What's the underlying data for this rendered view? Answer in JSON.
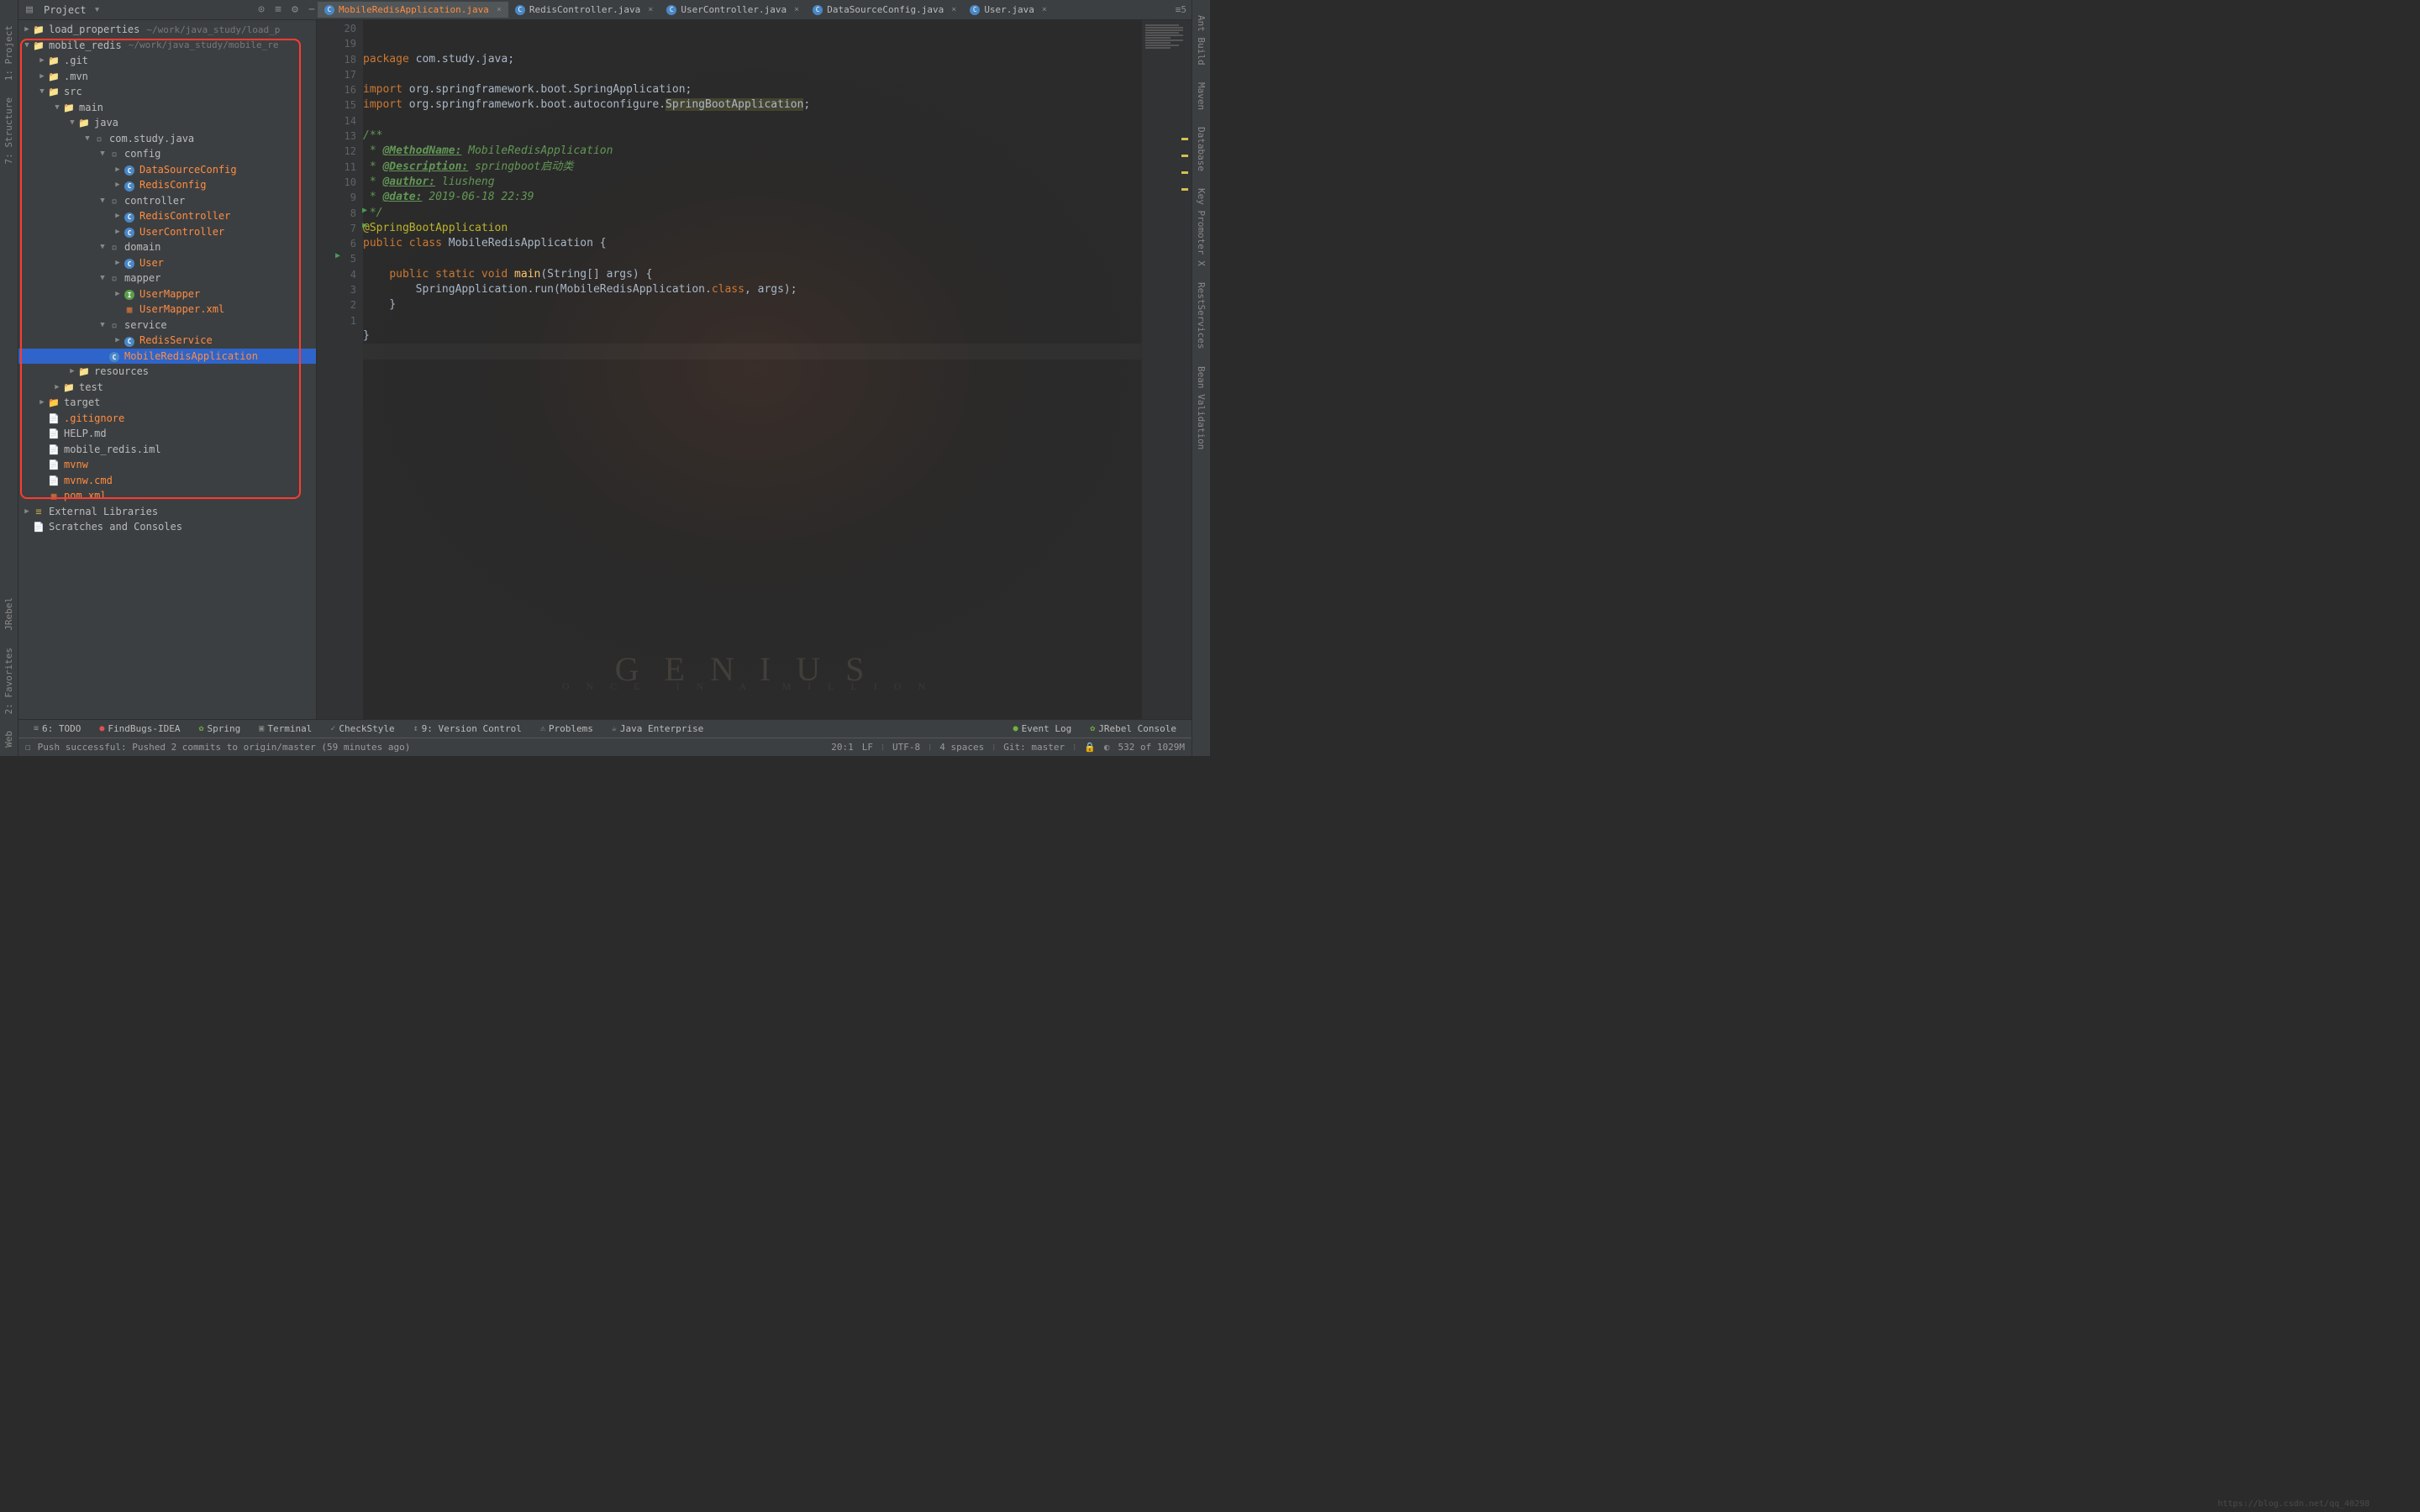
{
  "toolbar": {
    "project_label": "Project",
    "tabs": [
      {
        "label": "MobileRedisApplication.java",
        "active": true
      },
      {
        "label": "RedisController.java",
        "active": false
      },
      {
        "label": "UserController.java",
        "active": false
      },
      {
        "label": "DataSourceConfig.java",
        "active": false
      },
      {
        "label": "User.java",
        "active": false
      }
    ],
    "right_indicator": "≡5"
  },
  "left_tools": [
    "1: Project",
    "7: Structure",
    "JRebel",
    "2: Favorites",
    "Web"
  ],
  "right_tools": [
    "Ant Build",
    "Maven",
    "Database",
    "Key Promoter X",
    "RestServices",
    "Bean Validation"
  ],
  "tree": {
    "items": [
      {
        "depth": 0,
        "arrow": "▶",
        "icon": "folder",
        "label": "load_properties",
        "hint": "~/work/java_study/load_p",
        "hot": false
      },
      {
        "depth": 0,
        "arrow": "▼",
        "icon": "folder",
        "label": "mobile_redis",
        "hint": "~/work/java_study/mobile_re",
        "hot": false
      },
      {
        "depth": 1,
        "arrow": "▶",
        "icon": "folder",
        "label": ".git",
        "hot": false
      },
      {
        "depth": 1,
        "arrow": "▶",
        "icon": "folder",
        "label": ".mvn",
        "hot": false
      },
      {
        "depth": 1,
        "arrow": "▼",
        "icon": "folder",
        "label": "src",
        "hot": false
      },
      {
        "depth": 2,
        "arrow": "▼",
        "icon": "folder",
        "label": "main",
        "hot": false
      },
      {
        "depth": 3,
        "arrow": "▼",
        "icon": "folder",
        "label": "java",
        "hot": false
      },
      {
        "depth": 4,
        "arrow": "▼",
        "icon": "package",
        "label": "com.study.java",
        "hot": false
      },
      {
        "depth": 5,
        "arrow": "▼",
        "icon": "package",
        "label": "config",
        "hot": false
      },
      {
        "depth": 6,
        "arrow": "▶",
        "icon": "class",
        "label": "DataSourceConfig",
        "hot": true
      },
      {
        "depth": 6,
        "arrow": "▶",
        "icon": "class",
        "label": "RedisConfig",
        "hot": true
      },
      {
        "depth": 5,
        "arrow": "▼",
        "icon": "package",
        "label": "controller",
        "hot": false
      },
      {
        "depth": 6,
        "arrow": "▶",
        "icon": "class",
        "label": "RedisController",
        "hot": true
      },
      {
        "depth": 6,
        "arrow": "▶",
        "icon": "class",
        "label": "UserController",
        "hot": true
      },
      {
        "depth": 5,
        "arrow": "▼",
        "icon": "package",
        "label": "domain",
        "hot": false
      },
      {
        "depth": 6,
        "arrow": "▶",
        "icon": "class",
        "label": "User",
        "hot": true
      },
      {
        "depth": 5,
        "arrow": "▼",
        "icon": "package",
        "label": "mapper",
        "hot": false
      },
      {
        "depth": 6,
        "arrow": "▶",
        "icon": "interface",
        "label": "UserMapper",
        "hot": true
      },
      {
        "depth": 6,
        "arrow": "",
        "icon": "xml",
        "label": "UserMapper.xml",
        "hot": true
      },
      {
        "depth": 5,
        "arrow": "▼",
        "icon": "package",
        "label": "service",
        "hot": false
      },
      {
        "depth": 6,
        "arrow": "▶",
        "icon": "class",
        "label": "RedisService",
        "hot": true
      },
      {
        "depth": 5,
        "arrow": "",
        "icon": "class",
        "label": "MobileRedisApplication",
        "hot": true,
        "selected": true
      },
      {
        "depth": 3,
        "arrow": "▶",
        "icon": "folder",
        "label": "resources",
        "hot": false
      },
      {
        "depth": 2,
        "arrow": "▶",
        "icon": "folder",
        "label": "test",
        "hot": false
      },
      {
        "depth": 1,
        "arrow": "▶",
        "icon": "target",
        "label": "target",
        "hot": false
      },
      {
        "depth": 1,
        "arrow": "",
        "icon": "file",
        "label": ".gitignore",
        "hot": true
      },
      {
        "depth": 1,
        "arrow": "",
        "icon": "file",
        "label": "HELP.md",
        "hot": false
      },
      {
        "depth": 1,
        "arrow": "",
        "icon": "file",
        "label": "mobile_redis.iml",
        "hot": false
      },
      {
        "depth": 1,
        "arrow": "",
        "icon": "file",
        "label": "mvnw",
        "hot": true
      },
      {
        "depth": 1,
        "arrow": "",
        "icon": "file",
        "label": "mvnw.cmd",
        "hot": true
      },
      {
        "depth": 1,
        "arrow": "",
        "icon": "xml",
        "label": "pom.xml",
        "hot": true
      },
      {
        "depth": 0,
        "arrow": "▶",
        "icon": "lib",
        "label": "External Libraries",
        "hot": false
      },
      {
        "depth": 0,
        "arrow": "",
        "icon": "file",
        "label": "Scratches and Consoles",
        "hot": false
      }
    ]
  },
  "editor": {
    "lines": [
      "1",
      "2",
      "3",
      "4",
      "5",
      "6",
      "7",
      "8",
      "9",
      "10",
      "11",
      "12",
      "13",
      "14",
      "15",
      "16",
      "17",
      "18",
      "19",
      "20"
    ],
    "code_tokens": [
      [
        {
          "c": "kw",
          "t": "package "
        },
        {
          "c": "pkg",
          "t": "com.study.java"
        },
        {
          "c": "",
          "t": ";"
        }
      ],
      [],
      [
        {
          "c": "kw",
          "t": "import "
        },
        {
          "c": "pkg",
          "t": "org.springframework.boot.SpringApplication"
        },
        {
          "c": "",
          "t": ";"
        }
      ],
      [
        {
          "c": "kw",
          "t": "import "
        },
        {
          "c": "pkg",
          "t": "org.springframework.boot.autoconfigure."
        },
        {
          "c": "hl",
          "t": "SpringBootApplication"
        },
        {
          "c": "",
          "t": ";"
        }
      ],
      [],
      [
        {
          "c": "doc",
          "t": "/**"
        }
      ],
      [
        {
          "c": "doc",
          "t": " * "
        },
        {
          "c": "doctag",
          "t": "@MethodName:"
        },
        {
          "c": "doc",
          "t": " MobileRedisApplication"
        }
      ],
      [
        {
          "c": "doc",
          "t": " * "
        },
        {
          "c": "doctag",
          "t": "@Description:"
        },
        {
          "c": "doc",
          "t": " springboot启动类"
        }
      ],
      [
        {
          "c": "doc",
          "t": " * "
        },
        {
          "c": "doctag",
          "t": "@author:"
        },
        {
          "c": "doc",
          "t": " liusheng"
        }
      ],
      [
        {
          "c": "doc",
          "t": " * "
        },
        {
          "c": "doctag",
          "t": "@date:"
        },
        {
          "c": "doc",
          "t": " 2019-06-18 22:39"
        }
      ],
      [
        {
          "c": "doc",
          "t": " */"
        }
      ],
      [
        {
          "c": "ann",
          "t": "@SpringBootApplication"
        }
      ],
      [
        {
          "c": "kw",
          "t": "public class "
        },
        {
          "c": "cls",
          "t": "MobileRedisApplication "
        },
        {
          "c": "",
          "t": "{"
        }
      ],
      [],
      [
        {
          "c": "",
          "t": "    "
        },
        {
          "c": "kw",
          "t": "public static void "
        },
        {
          "c": "fn",
          "t": "main"
        },
        {
          "c": "",
          "t": "(String[] args) {"
        }
      ],
      [
        {
          "c": "",
          "t": "        SpringApplication."
        },
        {
          "c": "",
          "t": "run"
        },
        {
          "c": "",
          "t": "(MobileRedisApplication."
        },
        {
          "c": "kw",
          "t": "class"
        },
        {
          "c": "",
          "t": ", args);"
        }
      ],
      [
        {
          "c": "",
          "t": "    }"
        }
      ],
      [],
      [
        {
          "c": "",
          "t": "}"
        }
      ],
      []
    ]
  },
  "bottom_tabs": [
    {
      "icon": "≡",
      "label": "6: TODO"
    },
    {
      "icon": "●",
      "label": "FindBugs-IDEA",
      "color": "#e05050"
    },
    {
      "icon": "✿",
      "label": "Spring",
      "color": "#6db33f"
    },
    {
      "icon": "▣",
      "label": "Terminal"
    },
    {
      "icon": "✓",
      "label": "CheckStyle"
    },
    {
      "icon": "↕",
      "label": "9: Version Control"
    },
    {
      "icon": "⚠",
      "label": "Problems"
    },
    {
      "icon": "☕",
      "label": "Java Enterprise"
    }
  ],
  "bottom_right": [
    {
      "icon": "●",
      "label": "Event Log",
      "color": "#6db33f"
    },
    {
      "icon": "✿",
      "label": "JRebel Console",
      "color": "#6db33f"
    }
  ],
  "status": {
    "message_icon": "☐",
    "message": "Push successful: Pushed 2 commits to origin/master (59 minutes ago)",
    "pos": "20:1",
    "lf": "LF",
    "encoding": "UTF-8",
    "indent": "4 spaces",
    "git": "Git: master",
    "watermark": "GENIUS",
    "watermark_sub": "ONCE IN A MILLION",
    "blog": "https://blog.csdn.net/qq_40298",
    "mem": "532 of 1029M"
  }
}
